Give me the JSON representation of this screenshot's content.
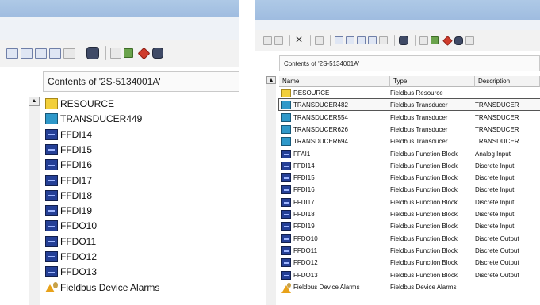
{
  "left_panel": {
    "path_label": "Contents of '2S-5134001A'",
    "items": [
      {
        "icon": "folder-icon",
        "label": "RESOURCE"
      },
      {
        "icon": "transducer-block-icon",
        "label": "TRANSDUCER449"
      },
      {
        "icon": "function-block-icon",
        "label": "FFDI14"
      },
      {
        "icon": "function-block-icon",
        "label": "FFDI15"
      },
      {
        "icon": "function-block-icon",
        "label": "FFDI16"
      },
      {
        "icon": "function-block-icon",
        "label": "FFDI17"
      },
      {
        "icon": "function-block-icon",
        "label": "FFDI18"
      },
      {
        "icon": "function-block-icon",
        "label": "FFDI19"
      },
      {
        "icon": "function-block-icon",
        "label": "FFDO10"
      },
      {
        "icon": "function-block-icon",
        "label": "FFDO11"
      },
      {
        "icon": "function-block-icon",
        "label": "FFDO12"
      },
      {
        "icon": "function-block-icon",
        "label": "FFDO13"
      },
      {
        "icon": "alarm-icon",
        "label": "Fieldbus Device Alarms"
      }
    ]
  },
  "right_panel": {
    "path_label": "Contents of '2S-5134001A'",
    "columns": [
      "Name",
      "Type",
      "Description"
    ],
    "rows": [
      {
        "icon": "folder-icon",
        "name": "RESOURCE",
        "type": "Fieldbus Resource",
        "description": ""
      },
      {
        "icon": "transducer-block-icon",
        "name": "TRANSDUCER482",
        "type": "Fieldbus Transducer",
        "description": "TRANSDUCER"
      },
      {
        "icon": "transducer-block-icon",
        "name": "TRANSDUCER554",
        "type": "Fieldbus Transducer",
        "description": "TRANSDUCER"
      },
      {
        "icon": "transducer-block-icon",
        "name": "TRANSDUCER626",
        "type": "Fieldbus Transducer",
        "description": "TRANSDUCER"
      },
      {
        "icon": "transducer-block-icon",
        "name": "TRANSDUCER694",
        "type": "Fieldbus Transducer",
        "description": "TRANSDUCER"
      },
      {
        "icon": "function-block-icon",
        "name": "FFAI1",
        "type": "Fieldbus Function Block",
        "description": "Analog Input"
      },
      {
        "icon": "function-block-icon",
        "name": "FFDI14",
        "type": "Fieldbus Function Block",
        "description": "Discrete Input"
      },
      {
        "icon": "function-block-icon",
        "name": "FFDI15",
        "type": "Fieldbus Function Block",
        "description": "Discrete Input"
      },
      {
        "icon": "function-block-icon",
        "name": "FFDI16",
        "type": "Fieldbus Function Block",
        "description": "Discrete Input"
      },
      {
        "icon": "function-block-icon",
        "name": "FFDI17",
        "type": "Fieldbus Function Block",
        "description": "Discrete Input"
      },
      {
        "icon": "function-block-icon",
        "name": "FFDI18",
        "type": "Fieldbus Function Block",
        "description": "Discrete Input"
      },
      {
        "icon": "function-block-icon",
        "name": "FFDI19",
        "type": "Fieldbus Function Block",
        "description": "Discrete Input"
      },
      {
        "icon": "function-block-icon",
        "name": "FFDO10",
        "type": "Fieldbus Function Block",
        "description": "Discrete Output"
      },
      {
        "icon": "function-block-icon",
        "name": "FFDO11",
        "type": "Fieldbus Function Block",
        "description": "Discrete Output"
      },
      {
        "icon": "function-block-icon",
        "name": "FFDO12",
        "type": "Fieldbus Function Block",
        "description": "Discrete Output"
      },
      {
        "icon": "function-block-icon",
        "name": "FFDO13",
        "type": "Fieldbus Function Block",
        "description": "Discrete Output"
      },
      {
        "icon": "alarm-icon",
        "name": "Fieldbus Device Alarms",
        "type": "Fieldbus Device Alarms",
        "description": ""
      }
    ]
  }
}
